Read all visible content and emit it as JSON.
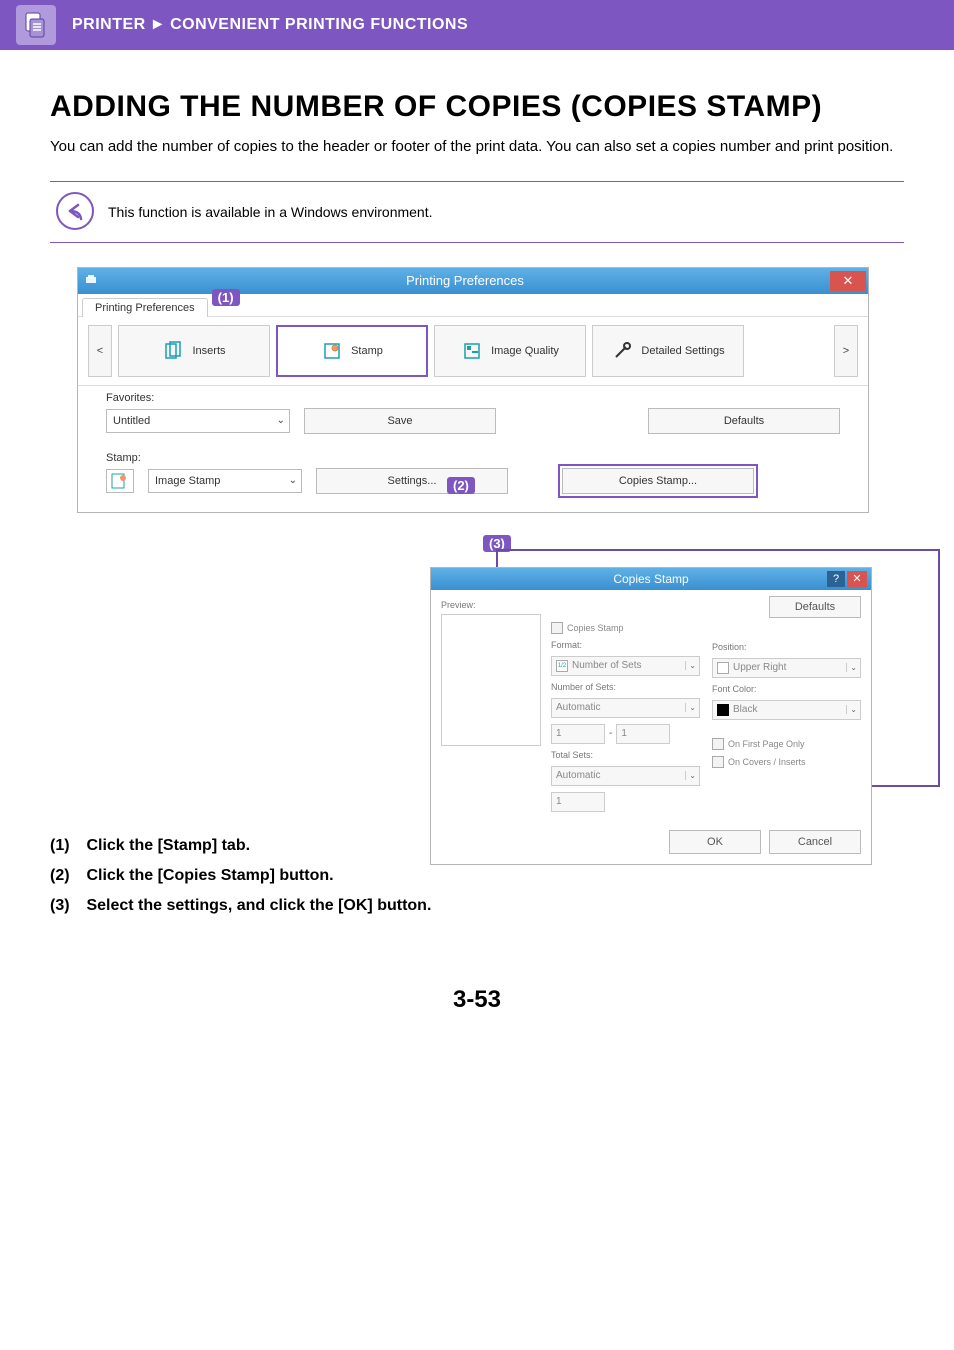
{
  "header": {
    "crumb1": "PRINTER",
    "crumb2": "CONVENIENT PRINTING FUNCTIONS"
  },
  "title": "ADDING THE NUMBER OF COPIES (COPIES STAMP)",
  "intro": "You can add the number of copies to the header or footer of the print data. You can also set a copies number and print position.",
  "note": "This function is available in a Windows environment.",
  "callouts": {
    "one": "(1)",
    "two": "(2)",
    "three": "(3)"
  },
  "prefs_window": {
    "title": "Printing Preferences",
    "tab_label": "Printing Preferences",
    "nav_prev": "<",
    "nav_next": ">",
    "tabs": {
      "inserts": "Inserts",
      "stamp": "Stamp",
      "image_quality": "Image Quality",
      "detailed_settings": "Detailed Settings"
    },
    "favorites_label": "Favorites:",
    "favorites_value": "Untitled",
    "save_btn": "Save",
    "defaults_btn": "Defaults",
    "stamp_label": "Stamp:",
    "stamp_value": "Image Stamp",
    "settings_btn": "Settings...",
    "copies_stamp_btn": "Copies Stamp..."
  },
  "copies_dialog": {
    "title": "Copies Stamp",
    "defaults_btn": "Defaults",
    "preview_label": "Preview:",
    "enable_check": "Copies Stamp",
    "format_label": "Format:",
    "format_value": "Number of Sets",
    "number_of_sets_label": "Number of Sets:",
    "number_of_sets_value": "Automatic",
    "range_from": "1",
    "range_dash": "-",
    "range_to": "1",
    "total_sets_label": "Total Sets:",
    "total_sets_value": "Automatic",
    "total_sets_num": "1",
    "position_label": "Position:",
    "position_value": "Upper Right",
    "font_color_label": "Font Color:",
    "font_color_value": "Black",
    "first_page_check": "On First Page Only",
    "covers_check": "On Covers / Inserts",
    "ok_btn": "OK",
    "cancel_btn": "Cancel"
  },
  "steps": {
    "s1_num": "(1)",
    "s1_txt": "Click the [Stamp] tab.",
    "s2_num": "(2)",
    "s2_txt": "Click the [Copies Stamp] button.",
    "s3_num": "(3)",
    "s3_txt": "Select the settings, and click the [OK] button."
  },
  "page_num": "3-53"
}
